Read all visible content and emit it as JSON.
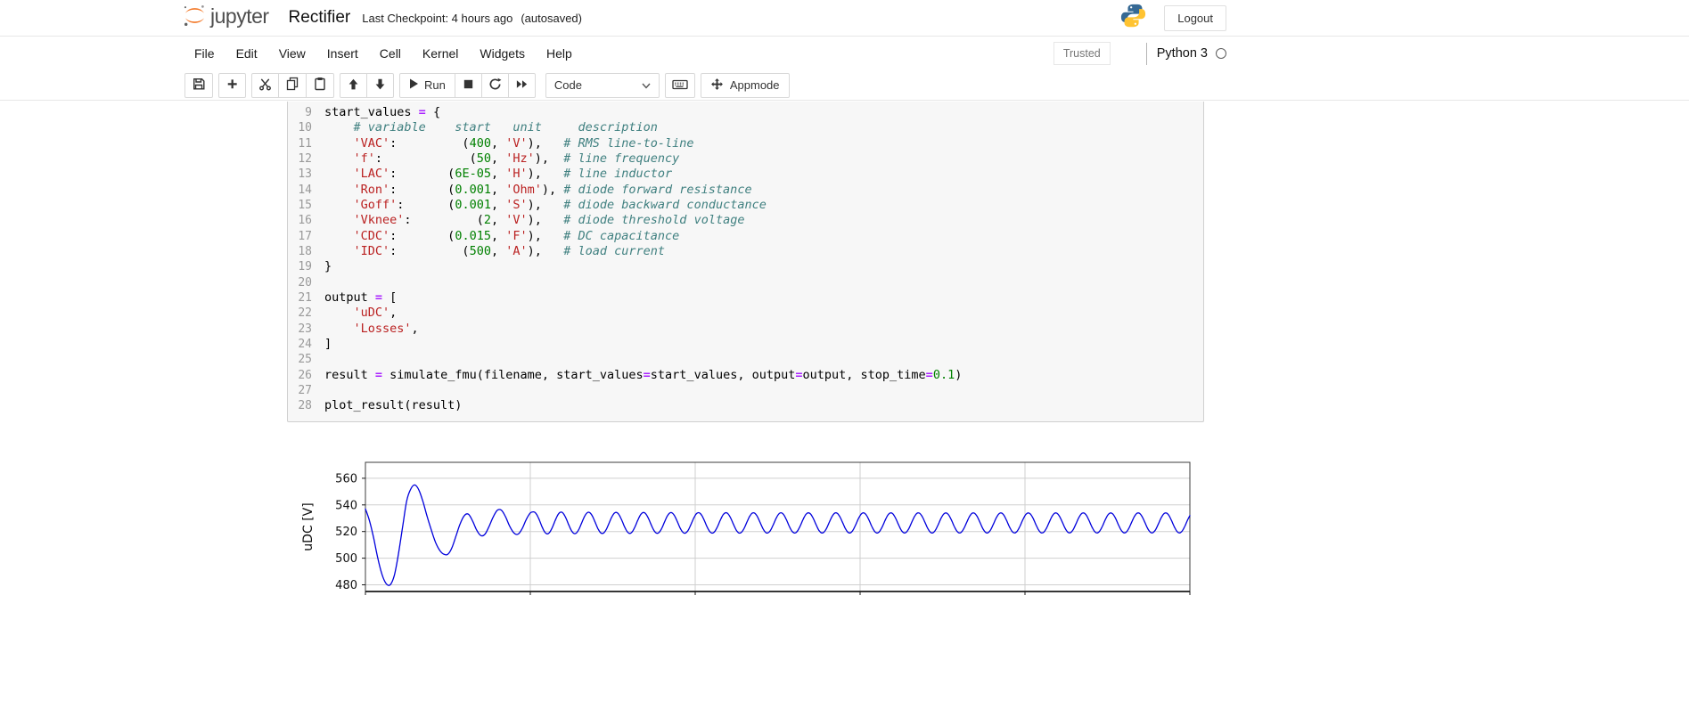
{
  "header": {
    "logo_text": "jupyter",
    "notebook_name": "Rectifier",
    "checkpoint_status": "Last Checkpoint: 4 hours ago",
    "autosave_status": "(autosaved)",
    "logout_label": "Logout"
  },
  "menu": {
    "items": [
      "File",
      "Edit",
      "View",
      "Insert",
      "Cell",
      "Kernel",
      "Widgets",
      "Help"
    ],
    "trusted_label": "Trusted",
    "kernel_name": "Python 3",
    "kernel_status": "idle"
  },
  "toolbar": {
    "run_label": "Run",
    "cell_type_selected": "Code",
    "appmode_label": "Appmode"
  },
  "code_cell": {
    "first_line_number": 9,
    "lines": [
      [
        [
          "p",
          "start_values "
        ],
        [
          "o",
          "="
        ],
        [
          "p",
          " {"
        ]
      ],
      [
        [
          "c",
          "    # variable    start   unit     description"
        ]
      ],
      [
        [
          "p",
          "    "
        ],
        [
          "s",
          "'VAC'"
        ],
        [
          "p",
          ":         ("
        ],
        [
          "m",
          "400"
        ],
        [
          "p",
          ", "
        ],
        [
          "s",
          "'V'"
        ],
        [
          "p",
          "),   "
        ],
        [
          "c",
          "# RMS line-to-line"
        ]
      ],
      [
        [
          "p",
          "    "
        ],
        [
          "s",
          "'f'"
        ],
        [
          "p",
          ":            ("
        ],
        [
          "m",
          "50"
        ],
        [
          "p",
          ", "
        ],
        [
          "s",
          "'Hz'"
        ],
        [
          "p",
          "),  "
        ],
        [
          "c",
          "# line frequency"
        ]
      ],
      [
        [
          "p",
          "    "
        ],
        [
          "s",
          "'LAC'"
        ],
        [
          "p",
          ":       ("
        ],
        [
          "m",
          "6E-05"
        ],
        [
          "p",
          ", "
        ],
        [
          "s",
          "'H'"
        ],
        [
          "p",
          "),   "
        ],
        [
          "c",
          "# line inductor"
        ]
      ],
      [
        [
          "p",
          "    "
        ],
        [
          "s",
          "'Ron'"
        ],
        [
          "p",
          ":       ("
        ],
        [
          "m",
          "0.001"
        ],
        [
          "p",
          ", "
        ],
        [
          "s",
          "'Ohm'"
        ],
        [
          "p",
          "), "
        ],
        [
          "c",
          "# diode forward resistance"
        ]
      ],
      [
        [
          "p",
          "    "
        ],
        [
          "s",
          "'Goff'"
        ],
        [
          "p",
          ":      ("
        ],
        [
          "m",
          "0.001"
        ],
        [
          "p",
          ", "
        ],
        [
          "s",
          "'S'"
        ],
        [
          "p",
          "),   "
        ],
        [
          "c",
          "# diode backward conductance"
        ]
      ],
      [
        [
          "p",
          "    "
        ],
        [
          "s",
          "'Vknee'"
        ],
        [
          "p",
          ":         ("
        ],
        [
          "m",
          "2"
        ],
        [
          "p",
          ", "
        ],
        [
          "s",
          "'V'"
        ],
        [
          "p",
          "),   "
        ],
        [
          "c",
          "# diode threshold voltage"
        ]
      ],
      [
        [
          "p",
          "    "
        ],
        [
          "s",
          "'CDC'"
        ],
        [
          "p",
          ":       ("
        ],
        [
          "m",
          "0.015"
        ],
        [
          "p",
          ", "
        ],
        [
          "s",
          "'F'"
        ],
        [
          "p",
          "),   "
        ],
        [
          "c",
          "# DC capacitance"
        ]
      ],
      [
        [
          "p",
          "    "
        ],
        [
          "s",
          "'IDC'"
        ],
        [
          "p",
          ":         ("
        ],
        [
          "m",
          "500"
        ],
        [
          "p",
          ", "
        ],
        [
          "s",
          "'A'"
        ],
        [
          "p",
          "),   "
        ],
        [
          "c",
          "# load current"
        ]
      ],
      [
        [
          "p",
          "}"
        ]
      ],
      [],
      [
        [
          "p",
          "output "
        ],
        [
          "o",
          "="
        ],
        [
          "p",
          " ["
        ]
      ],
      [
        [
          "p",
          "    "
        ],
        [
          "s",
          "'uDC'"
        ],
        [
          "p",
          ","
        ]
      ],
      [
        [
          "p",
          "    "
        ],
        [
          "s",
          "'Losses'"
        ],
        [
          "p",
          ","
        ]
      ],
      [
        [
          "p",
          "]"
        ]
      ],
      [],
      [
        [
          "p",
          "result "
        ],
        [
          "o",
          "="
        ],
        [
          "p",
          " simulate_fmu(filename, start_values"
        ],
        [
          "o",
          "="
        ],
        [
          "p",
          "start_values, output"
        ],
        [
          "o",
          "="
        ],
        [
          "p",
          "output, stop_time"
        ],
        [
          "o",
          "="
        ],
        [
          "m",
          "0.1"
        ],
        [
          "p",
          ")"
        ]
      ],
      [],
      [
        [
          "p",
          "plot_result(result)"
        ]
      ]
    ]
  },
  "chart_data": {
    "type": "line",
    "ylabel": "uDC [V]",
    "xlim": [
      0,
      0.1
    ],
    "ylim": [
      475,
      572
    ],
    "yticks": [
      480,
      500,
      520,
      540,
      560
    ],
    "x_gridlines": [
      0.02,
      0.04,
      0.06,
      0.08
    ],
    "grid": true,
    "legend_position": "none",
    "line_color": "#0000DC",
    "series": [
      {
        "name": "uDC",
        "unit": "V",
        "transient_points": [
          [
            0,
            537
          ],
          [
            0.0005,
            528
          ],
          [
            0.001,
            515
          ],
          [
            0.0015,
            500
          ],
          [
            0.002,
            488
          ],
          [
            0.0025,
            481
          ],
          [
            0.003,
            480
          ],
          [
            0.0035,
            487
          ],
          [
            0.004,
            503
          ],
          [
            0.0045,
            523
          ],
          [
            0.005,
            543
          ],
          [
            0.0055,
            552
          ],
          [
            0.006,
            555
          ],
          [
            0.0065,
            551
          ],
          [
            0.007,
            542
          ],
          [
            0.0075,
            531
          ],
          [
            0.008,
            521
          ],
          [
            0.0085,
            512
          ],
          [
            0.009,
            506
          ],
          [
            0.0095,
            503
          ],
          [
            0.01,
            503
          ],
          [
            0.0105,
            508
          ],
          [
            0.011,
            517
          ],
          [
            0.0115,
            526
          ],
          [
            0.012,
            532
          ],
          [
            0.0125,
            533
          ],
          [
            0.013,
            528
          ],
          [
            0.0135,
            521
          ],
          [
            0.014,
            517
          ],
          [
            0.0145,
            518
          ],
          [
            0.015,
            524
          ],
          [
            0.0155,
            531
          ],
          [
            0.016,
            536
          ],
          [
            0.0165,
            536
          ],
          [
            0.017,
            531
          ],
          [
            0.0175,
            524
          ],
          [
            0.018,
            519
          ],
          [
            0.0185,
            518
          ],
          [
            0.019,
            522
          ],
          [
            0.0195,
            529
          ],
          [
            0.02,
            534
          ]
        ],
        "steady_ripple": {
          "t_start": 0.0204,
          "t_end": 0.1,
          "sample_dt": 0.0002,
          "mean": 526.5,
          "amplitude": 7.5,
          "amplitude_extra": 0.8,
          "decay_tau": 0.015,
          "frequency_hz": 300
        }
      }
    ]
  },
  "colors": {
    "brand_orange": "#F37726",
    "string_token": "#BA2121",
    "number_token": "#008000",
    "operator_token": "#AA22FF",
    "comment_token": "#408080",
    "plot_line": "#0000DC"
  }
}
